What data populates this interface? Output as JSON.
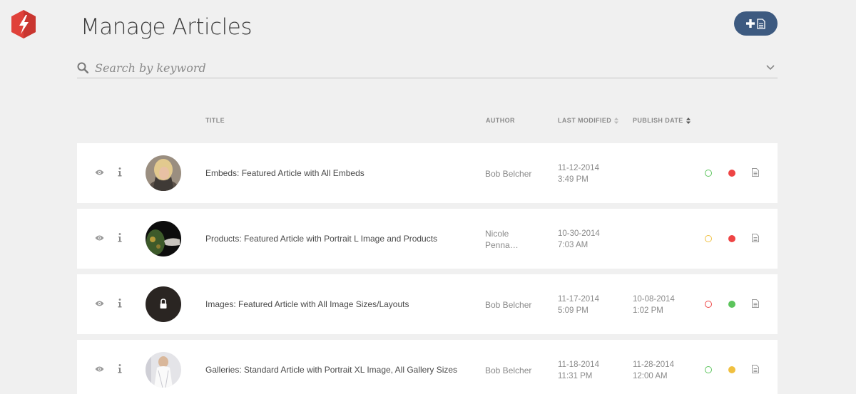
{
  "app": {
    "title": "Manage Articles"
  },
  "search": {
    "placeholder": "Search by keyword"
  },
  "table": {
    "columns": {
      "title": "TITLE",
      "author": "AUTHOR",
      "last_modified": "LAST MODIFIED",
      "publish_date": "PUBLISH DATE"
    },
    "rows": [
      {
        "title": "Embeds: Featured Article with All Embeds",
        "author": [
          "Bob Belcher",
          ""
        ],
        "modified_date": "11-12-2014",
        "modified_time": "3:49 PM",
        "publish_date": "",
        "publish_time": "",
        "status_outline": "#5cc45c",
        "status_fill": "#ee4444",
        "thumb": "portrait-blonde"
      },
      {
        "title": "Products: Featured Article with Portrait L Image and Products",
        "author": [
          "Nicole",
          "Penna…"
        ],
        "modified_date": "10-30-2014",
        "modified_time": "7:03 AM",
        "publish_date": "",
        "publish_time": "",
        "status_outline": "#f0c040",
        "status_fill": "#ee4444",
        "thumb": "hand-dark"
      },
      {
        "title": "Images: Featured Article with All Image Sizes/Layouts",
        "author": [
          "Bob Belcher",
          ""
        ],
        "modified_date": "11-17-2014",
        "modified_time": "5:09 PM",
        "publish_date": "10-08-2014",
        "publish_time": "1:02 PM",
        "status_outline": "#ee4444",
        "status_fill": "#5cc45c",
        "thumb": "locked"
      },
      {
        "title": "Galleries: Standard Article with Portrait XL Image, All Gallery Sizes",
        "author": [
          "Bob Belcher",
          ""
        ],
        "modified_date": "11-18-2014",
        "modified_time": "11:31 PM",
        "publish_date": "11-28-2014",
        "publish_time": "12:00 AM",
        "status_outline": "#5cc45c",
        "status_fill": "#f0c040",
        "thumb": "white-dress"
      }
    ]
  },
  "colors": {
    "accent": "#3d5a80",
    "logo": "#e0413a"
  },
  "icons": [
    "logo-icon",
    "add-icon",
    "document-icon",
    "search-icon",
    "chevron-down-icon",
    "eye-icon",
    "info-icon",
    "lock-icon",
    "sort-icon"
  ]
}
